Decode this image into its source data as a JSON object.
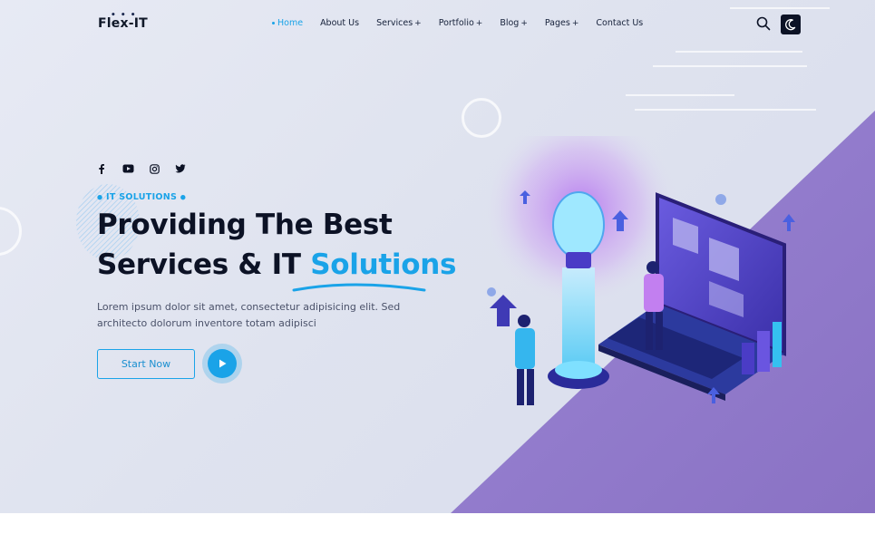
{
  "logo": "Flex-IT",
  "nav": {
    "items": [
      {
        "label": "Home",
        "active": true,
        "has_dropdown": false
      },
      {
        "label": "About Us",
        "active": false,
        "has_dropdown": false
      },
      {
        "label": "Services",
        "active": false,
        "has_dropdown": true
      },
      {
        "label": "Portfolio",
        "active": false,
        "has_dropdown": true
      },
      {
        "label": "Blog",
        "active": false,
        "has_dropdown": true
      },
      {
        "label": "Pages",
        "active": false,
        "has_dropdown": true
      },
      {
        "label": "Contact Us",
        "active": false,
        "has_dropdown": false
      }
    ],
    "dropdown_marker": "+"
  },
  "header_icons": [
    "search-icon",
    "moon-icon"
  ],
  "social": [
    "facebook-icon",
    "youtube-icon",
    "instagram-icon",
    "twitter-icon"
  ],
  "hero": {
    "tagline": "IT SOLUTIONS",
    "headline_line1": "Providing The Best",
    "headline_line2_prefix": "Services & IT",
    "headline_highlight": "Solutions",
    "description": "Lorem ipsum dolor sit amet, consectetur adipisicing elit. Sed architecto dolorum inventore totam adipisci",
    "cta_label": "Start Now"
  },
  "colors": {
    "accent": "#1aa3e8",
    "dark": "#0c1225",
    "purple": "#8e77c9",
    "background": "#e3e6f1"
  }
}
